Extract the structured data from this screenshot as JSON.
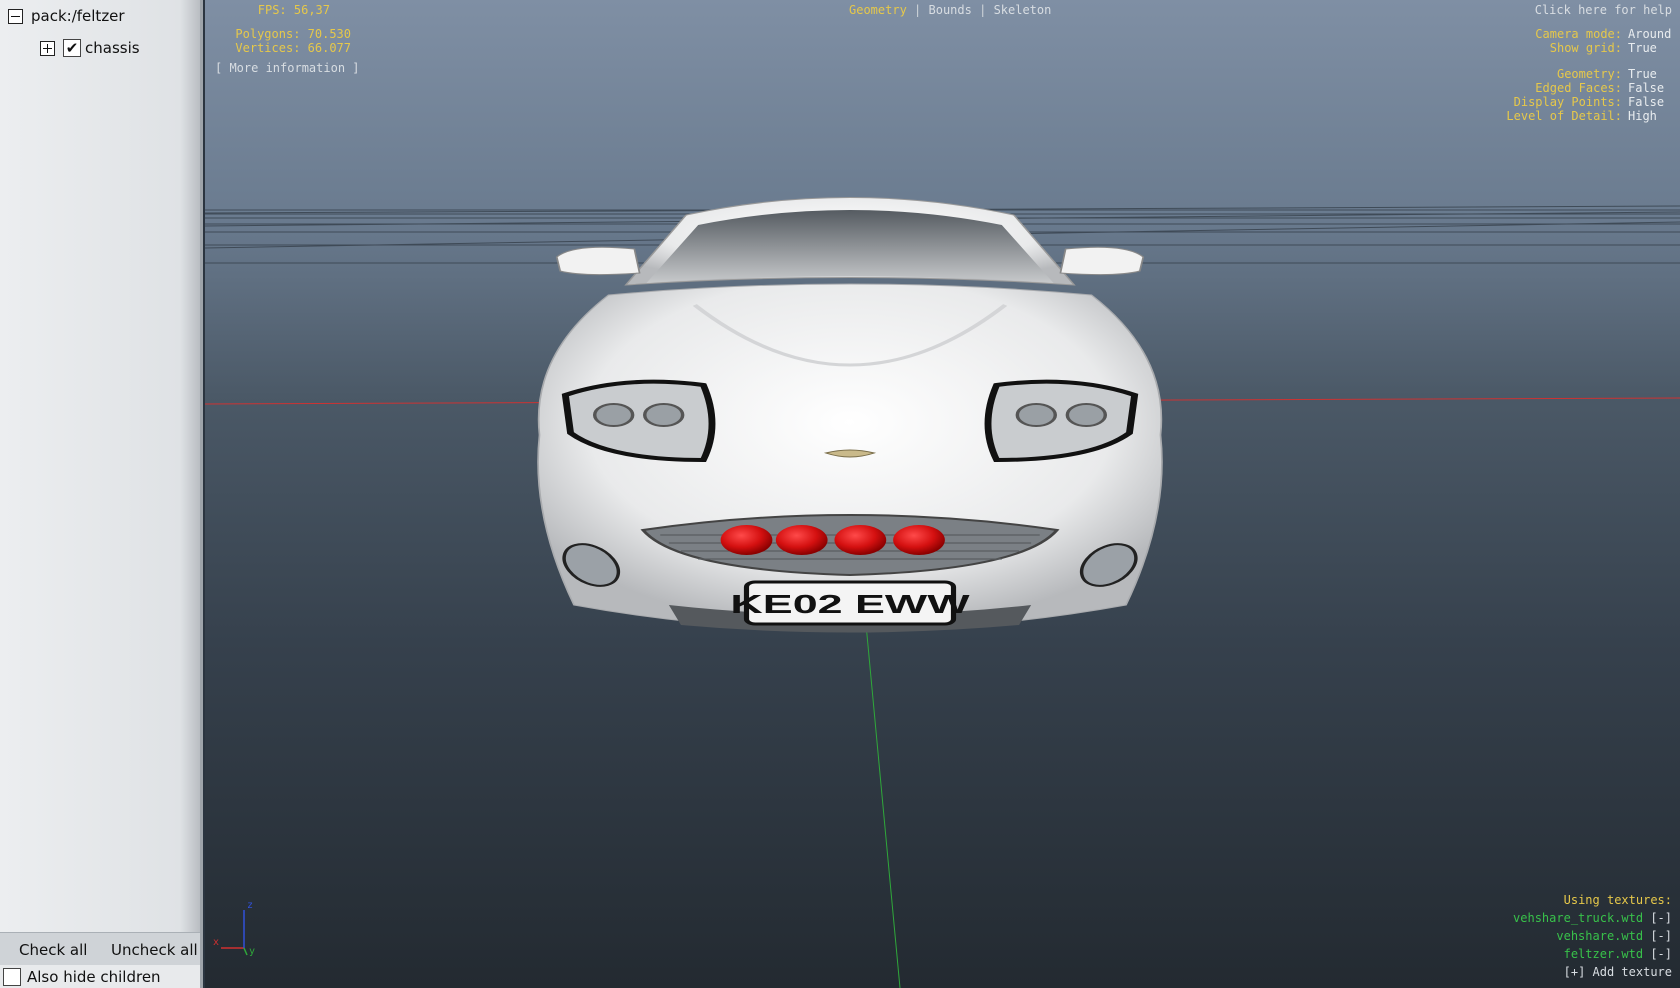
{
  "sidebar": {
    "root_label": "pack:/feltzer",
    "child_label": "chassis",
    "check_all_label": "Check all",
    "uncheck_all_label": "Uncheck all",
    "also_hide_label": "Also hide children"
  },
  "hud": {
    "fps": "FPS: 56,37",
    "polygons": "Polygons: 70.530",
    "vertices": "Vertices: 66.077",
    "more_info": "[ More information ]",
    "tab_geometry": "Geometry",
    "tab_bounds": "Bounds",
    "tab_skeleton": "Skeleton",
    "tab_separator": "|",
    "help": "Click here for help",
    "camera_mode_key": "Camera mode:",
    "camera_mode_val": "Around",
    "show_grid_key": "Show grid:",
    "show_grid_val": "True",
    "geometry_key": "Geometry:",
    "geometry_val": "True",
    "edged_faces_key": "Edged Faces:",
    "edged_faces_val": "False",
    "display_points_key": "Display Points:",
    "display_points_val": "False",
    "lod_key": "Level of Detail:",
    "lod_val": "High",
    "using_textures": "Using textures:",
    "textures": [
      "vehshare_truck.wtd",
      "vehshare.wtd",
      "feltzer.wtd"
    ],
    "remove_label": "[-]",
    "add_texture": "[+] Add texture"
  },
  "model": {
    "license_plate": "KE02 EWW"
  },
  "axis": {
    "x": "x",
    "y": "y",
    "z": "z"
  },
  "colors": {
    "hud_yellow": "#e6c84a",
    "hud_green": "#38c14a",
    "axis_red": "#d03030",
    "axis_green": "#2fa83a",
    "axis_blue": "#3050d8",
    "marker_red": "#d41010"
  }
}
